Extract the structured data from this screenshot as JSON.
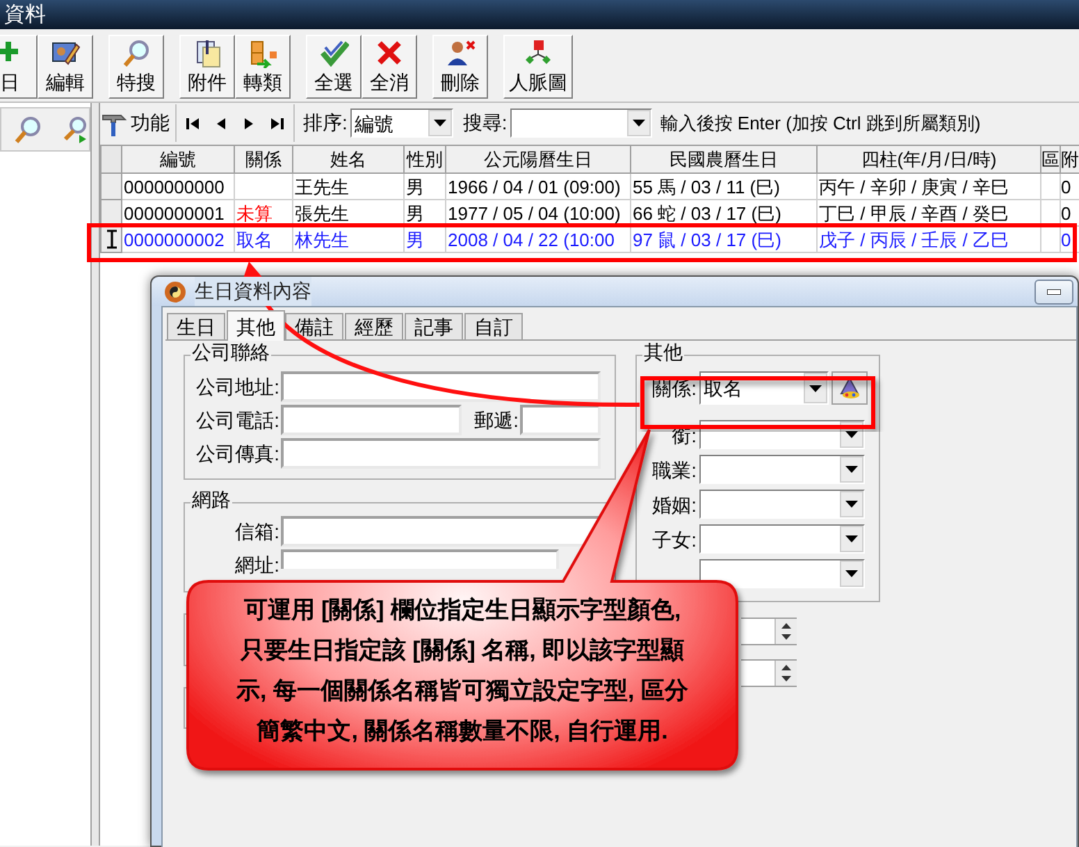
{
  "window": {
    "title": "資料"
  },
  "toolbar_groups": [
    {
      "buttons": [
        {
          "label": "日",
          "kind": "add"
        },
        {
          "label": "編輯",
          "kind": "edit"
        }
      ]
    },
    {
      "buttons": [
        {
          "label": "特搜",
          "kind": "search"
        }
      ]
    },
    {
      "buttons": [
        {
          "label": "附件",
          "kind": "attach"
        },
        {
          "label": "轉類",
          "kind": "move"
        }
      ]
    },
    {
      "buttons": [
        {
          "label": "全選",
          "kind": "check"
        },
        {
          "label": "全消",
          "kind": "cross"
        }
      ]
    },
    {
      "buttons": [
        {
          "label": "刪除",
          "kind": "delete"
        }
      ]
    },
    {
      "buttons": [
        {
          "label": "人脈圖",
          "kind": "tree"
        }
      ]
    }
  ],
  "nav_bar": {
    "function_label": "功能",
    "sort_label": "排序:",
    "sort_value": "編號",
    "search_label": "搜尋:",
    "hint": "輸入後按 Enter (加按 Ctrl 跳到所屬類別)"
  },
  "table": {
    "columns": [
      "編號",
      "關係",
      "姓名",
      "性別",
      "公元陽曆生日",
      "民國農曆生日",
      "四柱(年/月/日/時)",
      "區",
      "附"
    ],
    "rows": [
      {
        "current": false,
        "color": "#000000",
        "cells": [
          {
            "text": "0000000000"
          },
          {},
          {
            "text": "王先生"
          },
          {
            "text": "男"
          },
          {
            "text": "1966 / 04 / 01 (09:00)"
          },
          {
            "text": "55 馬 / 03 / 11 (巳)"
          },
          {
            "text": "丙午 / 辛卯 / 庚寅 / 辛巳"
          },
          {},
          {
            "text": "0"
          }
        ]
      },
      {
        "current": false,
        "color": "#000000",
        "cells": [
          {
            "text": "0000000001"
          },
          {
            "text": "未算",
            "color": "#ff0000"
          },
          {
            "text": "張先生"
          },
          {
            "text": "男"
          },
          {
            "text": "1977 / 05 / 04 (10:00)"
          },
          {
            "text": "66 蛇 / 03 / 17 (巳)"
          },
          {
            "text": "丁巳 / 甲辰 / 辛酉 / 癸巳"
          },
          {},
          {
            "text": "0"
          }
        ]
      },
      {
        "current": true,
        "color": "#1a1aff",
        "cells": [
          {
            "text": "0000000002"
          },
          {
            "text": "取名"
          },
          {
            "text": "林先生"
          },
          {
            "text": "男"
          },
          {
            "text": "2008 / 04 / 22 (10:00"
          },
          {
            "text": "97 鼠 / 03 / 17 (巳)"
          },
          {
            "text": "戊子 / 丙辰 / 壬辰 / 乙巳"
          },
          {},
          {
            "text": "0"
          }
        ]
      }
    ]
  },
  "dialog": {
    "title": "生日資料內容",
    "tabs": [
      {
        "label": "生日",
        "selected": false
      },
      {
        "label": "其他",
        "selected": true
      },
      {
        "label": "備註",
        "selected": false
      },
      {
        "label": "經歷",
        "selected": false
      },
      {
        "label": "記事",
        "selected": false
      },
      {
        "label": "自訂",
        "selected": false
      }
    ],
    "company": {
      "title": "公司聯絡",
      "address_label": "公司地址:",
      "phone_label": "公司電話:",
      "zip_label": "郵遞:",
      "fax_label": "公司傳真:"
    },
    "network": {
      "title": "網路",
      "fields": [
        {
          "label": "信箱:"
        },
        {
          "label": "網址:"
        }
      ]
    },
    "other": {
      "title": "其他",
      "relation": {
        "label": "關係:",
        "value": "取名"
      },
      "combos": [
        {
          "kind": "labeled",
          "label": "銜:"
        },
        {
          "kind": "labeled",
          "label": "職業:"
        },
        {
          "kind": "labeled",
          "label": "婚姻:"
        },
        {
          "kind": "labeled",
          "label": "子女:"
        },
        {
          "kind": "plain"
        }
      ]
    }
  },
  "callout": {
    "lines": [
      "可運用 [關係] 欄位指定生日顯示字型顏色,",
      "只要生日指定該 [關係] 名稱, 即以該字型顯",
      "示, 每一個關係名稱皆可獨立設定字型, 區分",
      "簡繁中文, 關係名稱數量不限, 自行運用."
    ]
  }
}
